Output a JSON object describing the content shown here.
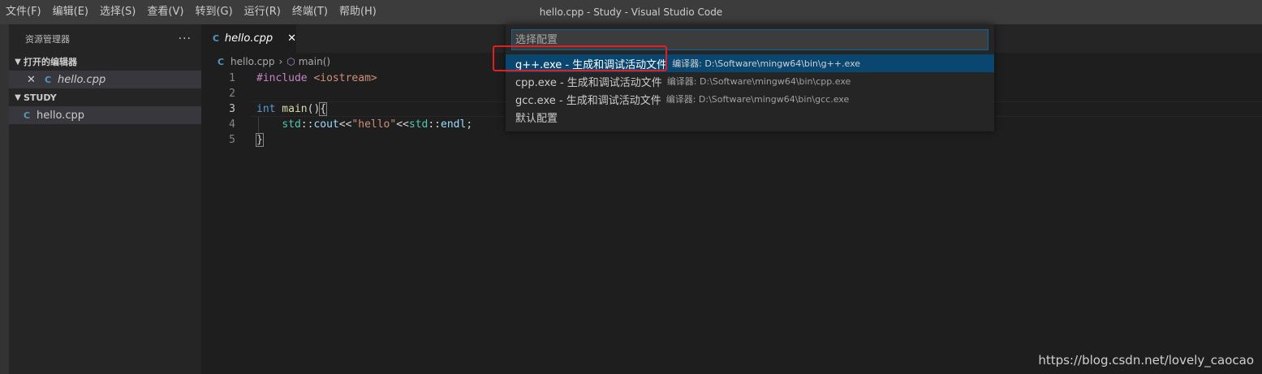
{
  "titlebar": {
    "menu": [
      "文件(F)",
      "编辑(E)",
      "选择(S)",
      "查看(V)",
      "转到(G)",
      "运行(R)",
      "终端(T)",
      "帮助(H)"
    ],
    "title": "hello.cpp - Study - Visual Studio Code"
  },
  "sidebar": {
    "title": "资源管理器",
    "more": "···",
    "open_editors_header": "打开的编辑器",
    "open_editors": [
      {
        "icon": "C",
        "name": "hello.cpp",
        "close": "✕"
      }
    ],
    "folder_header": "STUDY",
    "files": [
      {
        "icon": "C",
        "name": "hello.cpp"
      }
    ]
  },
  "editor": {
    "tab": {
      "icon": "C",
      "label": "hello.cpp",
      "close": "✕"
    },
    "breadcrumb": {
      "file": "hello.cpp",
      "sep": "›",
      "symbol": "main()"
    },
    "line_numbers": [
      "1",
      "2",
      "3",
      "4",
      "5"
    ],
    "code": {
      "l1_pp": "#include",
      "l1_hdr": " <iostream>",
      "l3_kw": "int",
      "l3_fn": " main",
      "l3_rest": "()",
      "l3_brace": "{",
      "l4_indent": "    ",
      "l4_ns1": "std",
      "l4_op1": "::",
      "l4_id1": "cout",
      "l4_op2": "<<",
      "l4_str": "\"hello\"",
      "l4_op3": "<<",
      "l4_ns2": "std",
      "l4_op4": "::",
      "l4_id2": "endl",
      "l4_end": ";",
      "l5_brace": "}"
    }
  },
  "quickpick": {
    "placeholder": "选择配置",
    "items": [
      {
        "label": "g++.exe - 生成和调试活动文件",
        "description": "编译器: D:\\Software\\mingw64\\bin\\g++.exe"
      },
      {
        "label": "cpp.exe - 生成和调试活动文件",
        "description": "编译器: D:\\Software\\mingw64\\bin\\cpp.exe"
      },
      {
        "label": "gcc.exe - 生成和调试活动文件",
        "description": "编译器: D:\\Software\\mingw64\\bin\\gcc.exe"
      },
      {
        "label": "默认配置",
        "description": ""
      }
    ]
  },
  "watermark": "https://blog.csdn.net/lovely_caocao",
  "colors": {
    "accent": "#0e639c",
    "selection": "#094771",
    "highlight": "#e02020"
  }
}
